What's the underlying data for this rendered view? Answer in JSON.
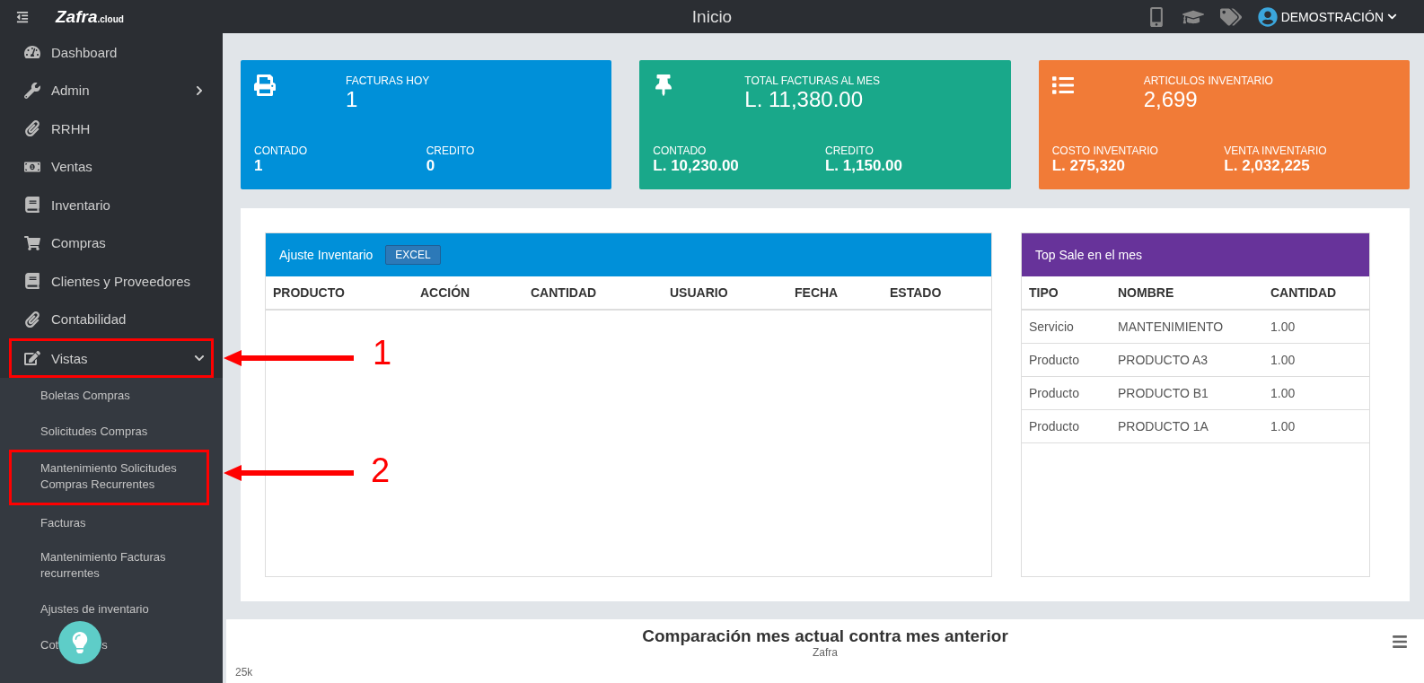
{
  "topbar": {
    "logo": "Zafra",
    "logo_suffix": ".cloud",
    "title": "Inicio",
    "user": "DEMOSTRACIÓN"
  },
  "sidebar": {
    "items": [
      {
        "label": "Dashboard",
        "kind": "link"
      },
      {
        "label": "Admin",
        "kind": "group",
        "expanded": false
      },
      {
        "label": "RRHH",
        "kind": "link"
      },
      {
        "label": "Ventas",
        "kind": "link"
      },
      {
        "label": "Inventario",
        "kind": "link"
      },
      {
        "label": "Compras",
        "kind": "link"
      },
      {
        "label": "Clientes y Proveedores",
        "kind": "link"
      },
      {
        "label": "Contabilidad",
        "kind": "link"
      },
      {
        "label": "Vistas",
        "kind": "group",
        "expanded": true,
        "annotation": "1",
        "children": [
          {
            "label": "Boletas Compras"
          },
          {
            "label": "Solicitudes Compras"
          },
          {
            "label": "Mantenimiento Solicitudes Compras Recurrentes",
            "annotation": "2"
          },
          {
            "label": "Facturas"
          },
          {
            "label": "Mantenimiento Facturas recurrentes"
          },
          {
            "label": "Ajustes de inventario"
          },
          {
            "label": "Cot",
            "label_end": "s"
          }
        ]
      }
    ]
  },
  "cards": [
    {
      "title": "FACTURAS HOY",
      "value": "1",
      "color": "#0090d9",
      "stats": [
        {
          "label": "CONTADO",
          "value": "1"
        },
        {
          "label": "CREDITO",
          "value": "0"
        }
      ]
    },
    {
      "title": "TOTAL FACTURAS AL MES",
      "value": "L. 11,380.00",
      "color": "#19a88a",
      "stats": [
        {
          "label": "CONTADO",
          "value": "L. 10,230.00"
        },
        {
          "label": "CREDITO",
          "value": "L. 1,150.00"
        }
      ]
    },
    {
      "title": "ARTICULOS INVENTARIO",
      "value": "2,699",
      "color": "#f17b37",
      "stats": [
        {
          "label": "COSTO INVENTARIO",
          "value": "L. 275,320"
        },
        {
          "label": "VENTA INVENTARIO",
          "value": "L. 2,032,225"
        }
      ]
    }
  ],
  "ajuste_inventario": {
    "title": "Ajuste Inventario",
    "button": "EXCEL",
    "columns": [
      "PRODUCTO",
      "ACCIÓN",
      "CANTIDAD",
      "USUARIO",
      "FECHA",
      "ESTADO"
    ]
  },
  "top_sale": {
    "title": "Top Sale en el mes",
    "columns": [
      "TIPO",
      "NOMBRE",
      "CANTIDAD"
    ],
    "rows": [
      [
        "Servicio",
        "MANTENIMIENTO",
        "1.00"
      ],
      [
        "Producto",
        "PRODUCTO A3",
        "1.00"
      ],
      [
        "Producto",
        "PRODUCTO B1",
        "1.00"
      ],
      [
        "Producto",
        "PRODUCTO 1A",
        "1.00"
      ]
    ]
  },
  "chart": {
    "title": "Comparación mes actual contra mes anterior",
    "subtitle": "Zafra",
    "ytick": "25k"
  }
}
